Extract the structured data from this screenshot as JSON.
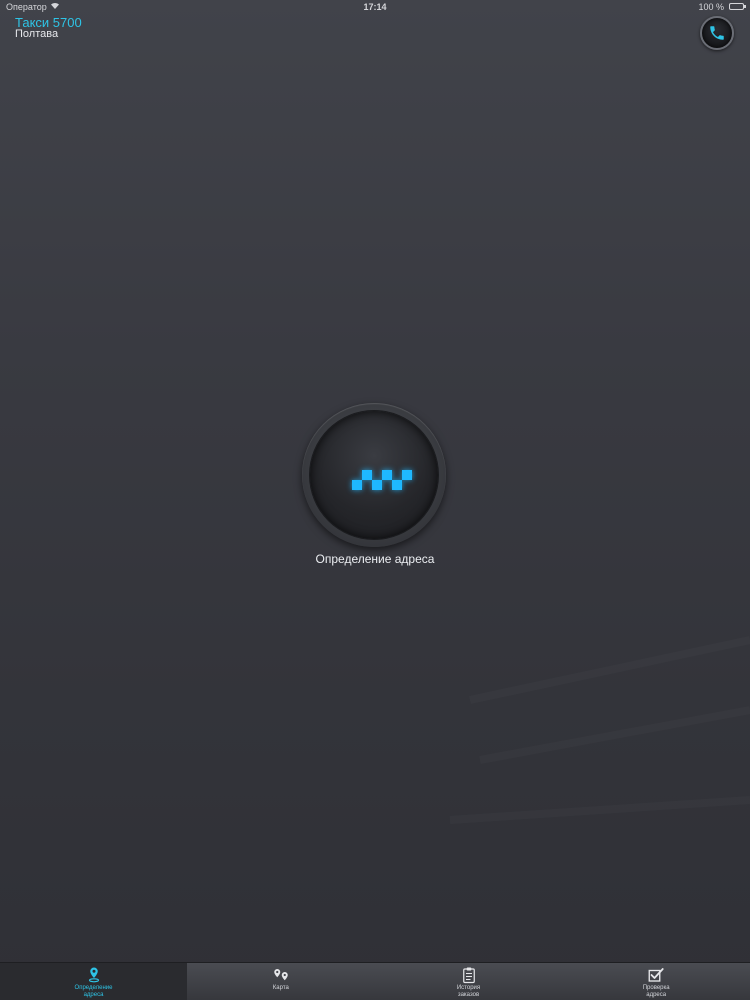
{
  "status_bar": {
    "carrier": "Оператор",
    "time": "17:14",
    "battery": "100 %"
  },
  "header": {
    "app_title": "Такси 5700",
    "city": "Полтава",
    "call_icon": "phone-icon"
  },
  "loader": {
    "icon": "taxi-checker-icon",
    "label": "Определение адреса"
  },
  "tabs": [
    {
      "label": "Определение\nадреса",
      "icon": "location-pin-icon",
      "active": true
    },
    {
      "label": "Карта",
      "icon": "map-pins-icon",
      "active": false
    },
    {
      "label": "История\nзаказов",
      "icon": "clipboard-icon",
      "active": false
    },
    {
      "label": "Проверка\nадреса",
      "icon": "checkbox-icon",
      "active": false
    }
  ],
  "colors": {
    "accent": "#2ec4e6",
    "checker": "#1fb8ff",
    "background": "#393a41"
  }
}
